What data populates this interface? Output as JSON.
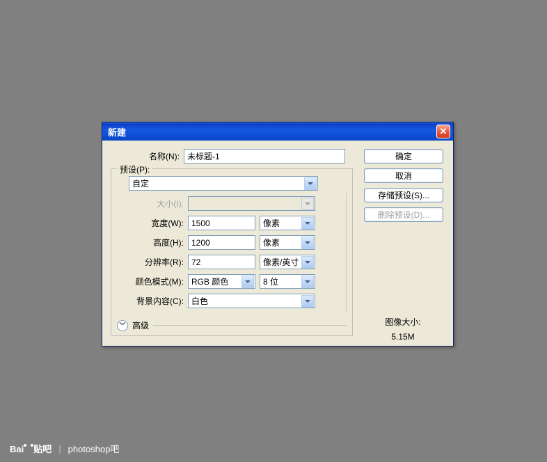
{
  "dialog": {
    "title": "新建",
    "close_icon": "✕"
  },
  "labels": {
    "name": "名称(N):",
    "preset": "预设(P):",
    "size": "大小(I):",
    "width": "宽度(W):",
    "height": "高度(H):",
    "resolution": "分辨率(R):",
    "color_mode": "颜色模式(M):",
    "bg_content": "背景内容(C):",
    "advanced": "高级",
    "image_size": "图像大小:"
  },
  "values": {
    "name": "未标题-1",
    "preset": "自定",
    "size": "",
    "width": "1500",
    "width_unit": "像素",
    "height": "1200",
    "height_unit": "像素",
    "resolution": "72",
    "resolution_unit": "像素/英寸",
    "color_mode": "RGB 颜色",
    "bit_depth": "8 位",
    "bg_content": "白色",
    "image_size": "5.15M"
  },
  "buttons": {
    "ok": "确定",
    "cancel": "取消",
    "save_preset": "存储预设(S)...",
    "delete_preset": "删除预设(D)..."
  },
  "footer": {
    "brand": "Bai",
    "brand2": "贴吧",
    "section": "photoshop吧"
  }
}
